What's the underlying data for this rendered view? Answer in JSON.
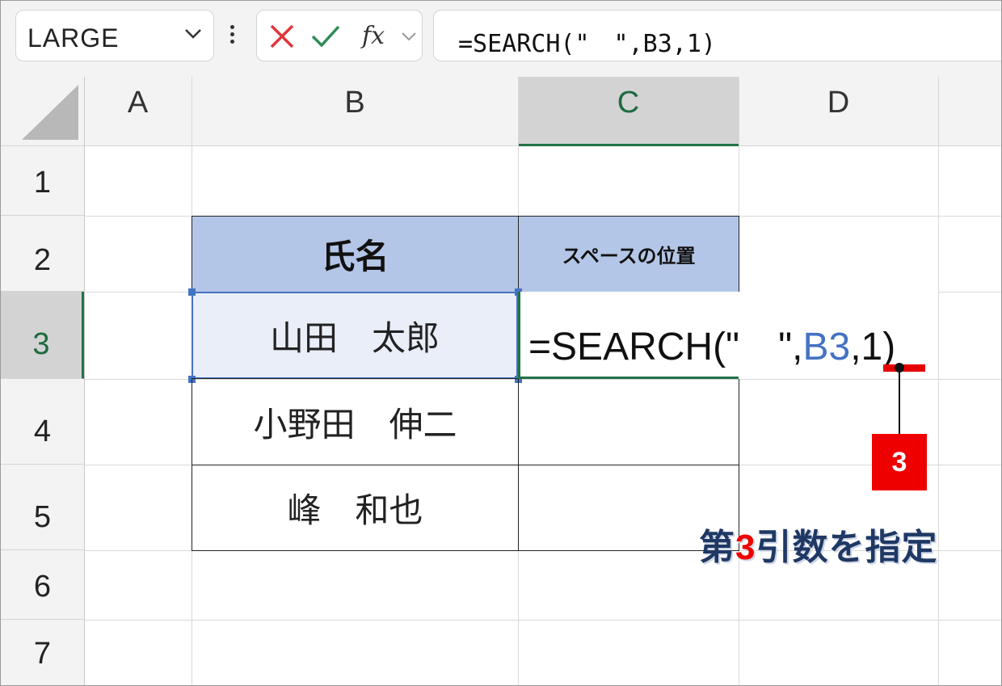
{
  "formula_bar": {
    "name_box": "LARGE",
    "fx_label": "fx",
    "formula": "=SEARCH(\"　\",B3,1)"
  },
  "columns": [
    "A",
    "B",
    "C",
    "D"
  ],
  "rows": [
    "1",
    "2",
    "3",
    "4",
    "5",
    "6",
    "7"
  ],
  "table": {
    "header_name": "氏名",
    "header_position": "スペースの位置",
    "names": [
      "山田　太郎",
      "小野田　伸二",
      "峰　和也"
    ]
  },
  "edit_cell": {
    "prefix": "=SEARCH(\"　\",",
    "ref": "B3",
    "suffix": ",1)"
  },
  "annotation": {
    "badge": "3",
    "caption_prefix": "第",
    "caption_num": "3",
    "caption_suffix": "引数を指定"
  },
  "colors": {
    "selection_green": "#217346",
    "header_fill": "#b4c6e7",
    "range_blue": "#4472c4",
    "marker_red": "#e60000",
    "caption_navy": "#1f3864"
  }
}
